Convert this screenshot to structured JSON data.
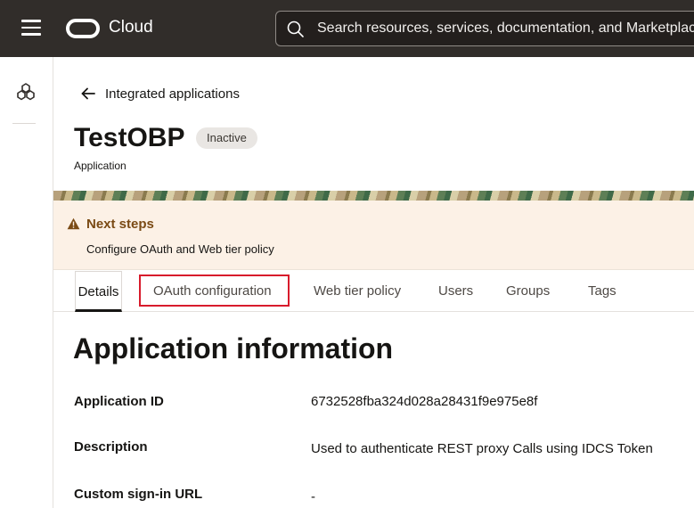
{
  "topbar": {
    "brand": "Cloud",
    "search_placeholder": "Search resources, services, documentation, and Marketplace"
  },
  "breadcrumb": {
    "back_label": "Integrated applications"
  },
  "header": {
    "title": "TestOBP",
    "status": "Inactive",
    "subtitle": "Application"
  },
  "notice": {
    "title": "Next steps",
    "text": "Configure OAuth and Web tier policy"
  },
  "tabs": [
    {
      "label": "Details",
      "active": true
    },
    {
      "label": "OAuth configuration",
      "active": false,
      "highlighted": true
    },
    {
      "label": "Web tier policy",
      "active": false
    },
    {
      "label": "Users",
      "active": false
    },
    {
      "label": "Groups",
      "active": false
    },
    {
      "label": "Tags",
      "active": false
    }
  ],
  "section": {
    "title": "Application information",
    "rows": [
      {
        "label": "Application ID",
        "value": "6732528fba324d028a28431f9e975e8f"
      },
      {
        "label": "Description",
        "value": "Used to authenticate REST proxy Calls using IDCS Token"
      },
      {
        "label": "Custom sign-in URL",
        "value": "-"
      }
    ]
  },
  "colors": {
    "topbar": "#312d2a",
    "notice_bg": "#fcf1e6",
    "notice_title": "#7a4a14",
    "highlight": "#d81b2c"
  },
  "icons": {
    "menu": "hamburger-icon",
    "logo": "oracle-logo-icon",
    "search": "search-icon",
    "rail": "cubes-icon",
    "back": "arrow-left-icon",
    "warning": "warning-icon"
  }
}
